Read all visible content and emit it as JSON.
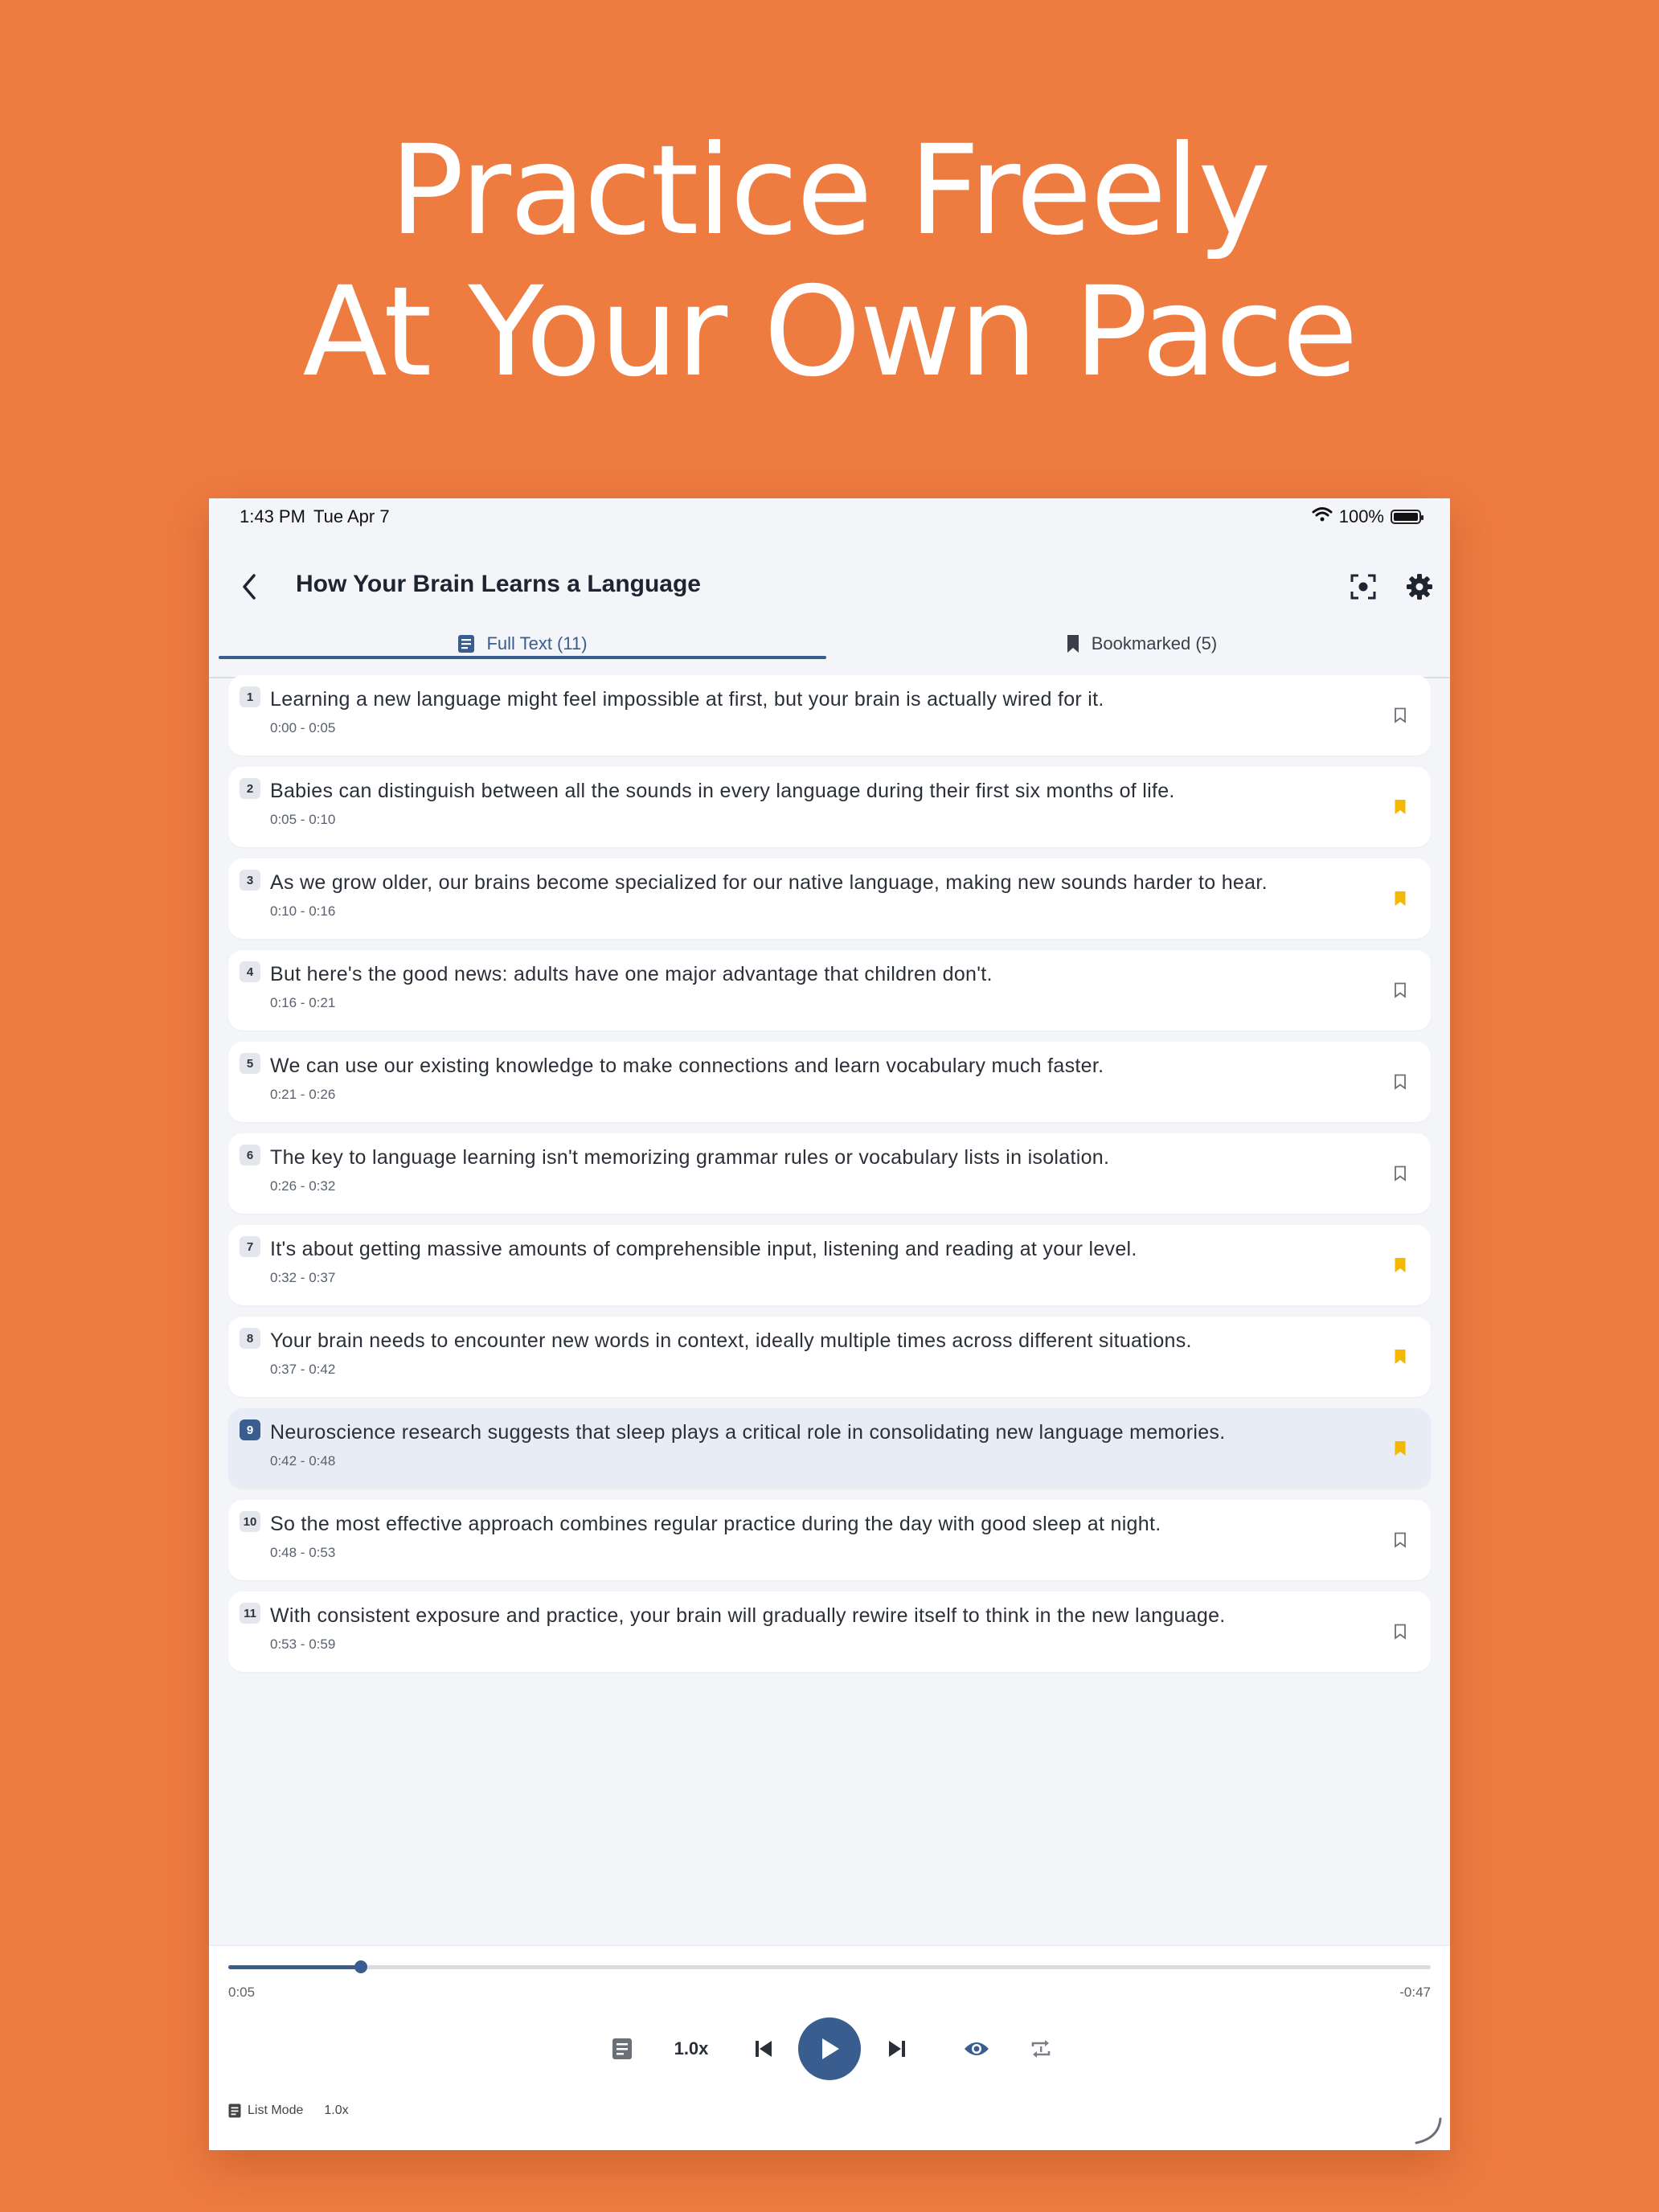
{
  "headline": {
    "line1": "Practice Freely",
    "line2": "At Your Own Pace"
  },
  "status_bar": {
    "time": "1:43 PM",
    "date": "Tue Apr 7",
    "battery": "100%"
  },
  "nav": {
    "title": "How Your Brain Learns a Language"
  },
  "tabs": {
    "full_text": "Full Text (11)",
    "bookmarked": "Bookmarked (5)"
  },
  "colors": {
    "background": "#EE7B40",
    "accent": "#3A5D8F",
    "bookmark": "#F5B800"
  },
  "sentences": [
    {
      "num": "1",
      "text": "Learning a new language might feel impossible at first, but your brain is actually wired for it.",
      "time": "0:00 - 0:05",
      "bookmarked": false
    },
    {
      "num": "2",
      "text": "Babies can distinguish between all the sounds in every language during their first six months of life.",
      "time": "0:05 - 0:10",
      "bookmarked": true
    },
    {
      "num": "3",
      "text": "As we grow older, our brains become specialized for our native language, making new sounds harder to hear.",
      "time": "0:10 - 0:16",
      "bookmarked": true
    },
    {
      "num": "4",
      "text": "But here's the good news: adults have one major advantage that children don't.",
      "time": "0:16 - 0:21",
      "bookmarked": false
    },
    {
      "num": "5",
      "text": "We can use our existing knowledge to make connections and learn vocabulary much faster.",
      "time": "0:21 - 0:26",
      "bookmarked": false
    },
    {
      "num": "6",
      "text": "The key to language learning isn't memorizing grammar rules or vocabulary lists in isolation.",
      "time": "0:26 - 0:32",
      "bookmarked": false
    },
    {
      "num": "7",
      "text": "It's about getting massive amounts of comprehensible input, listening and reading at your level.",
      "time": "0:32 - 0:37",
      "bookmarked": true
    },
    {
      "num": "8",
      "text": "Your brain needs to encounter new words in context, ideally multiple times across different situations.",
      "time": "0:37 - 0:42",
      "bookmarked": true
    },
    {
      "num": "9",
      "text": "Neuroscience research suggests that sleep plays a critical role in consolidating new language memories.",
      "time": "0:42 - 0:48",
      "bookmarked": true,
      "active": true
    },
    {
      "num": "10",
      "text": "So the most effective approach combines regular practice during the day with good sleep at night.",
      "time": "0:48 - 0:53",
      "bookmarked": false
    },
    {
      "num": "11",
      "text": "With consistent exposure and practice, your brain will gradually rewire itself to think in the new language.",
      "time": "0:53 - 0:59",
      "bookmarked": false
    }
  ],
  "player": {
    "elapsed": "0:05",
    "remaining": "-0:47",
    "progress": 0.11,
    "speed": "1.0x",
    "footer_mode": "List Mode",
    "footer_speed": "1.0x"
  }
}
